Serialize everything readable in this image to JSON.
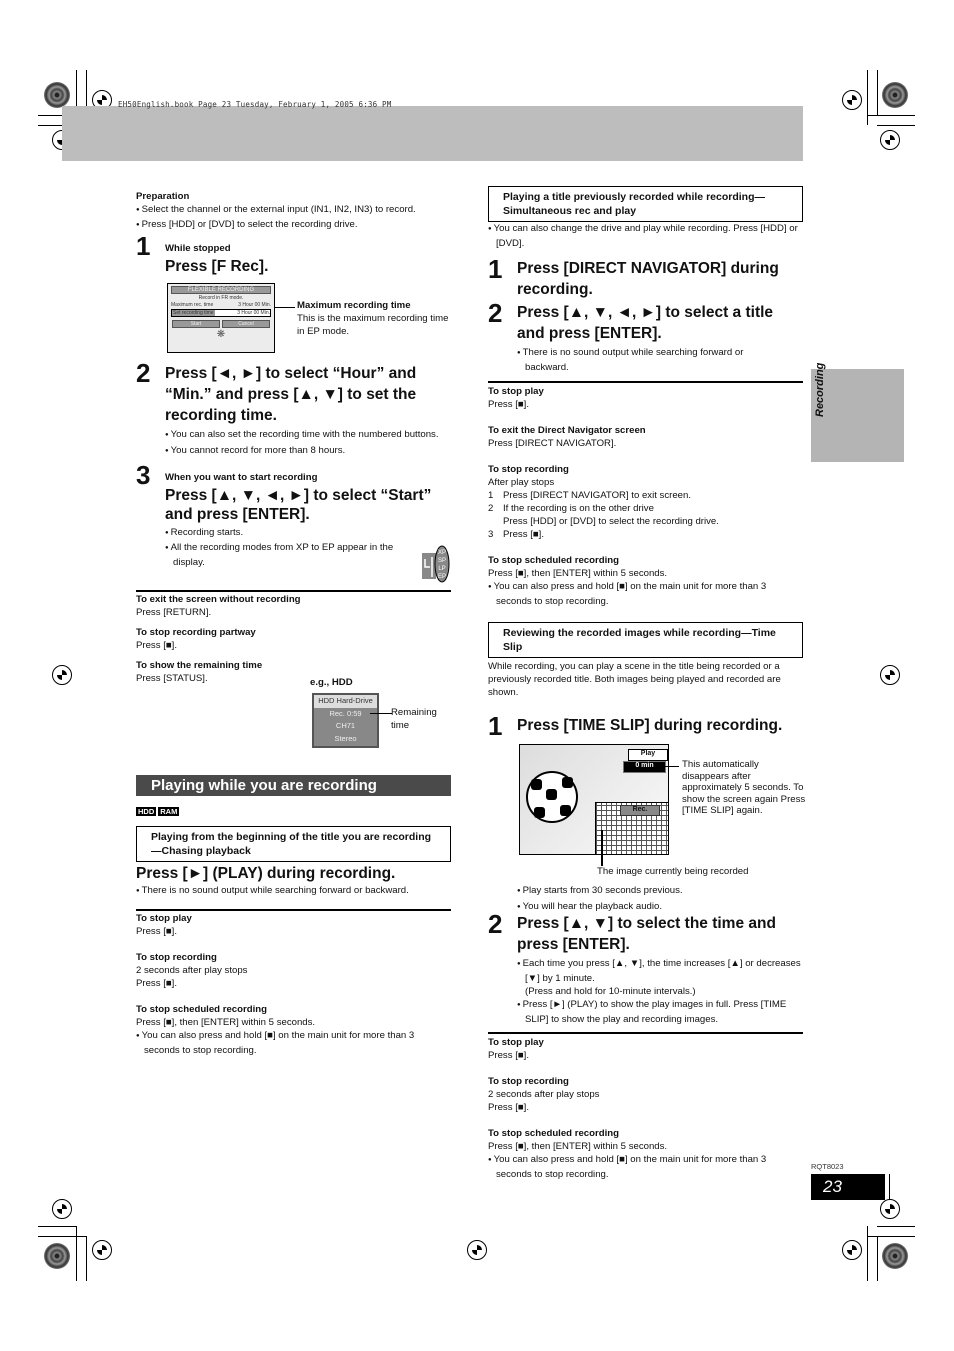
{
  "print_header": "EH50English.book  Page 23  Tuesday, February 1, 2005  6:36 PM",
  "side_tab": "Recording",
  "footer": {
    "code": "RQT8023",
    "page_number": "23"
  },
  "left": {
    "preparation": {
      "title": "Preparation",
      "bullets": [
        "Select the channel or the external input (IN1, IN2, IN3) to record.",
        "Press [HDD] or [DVD] to select the recording drive."
      ]
    },
    "step1": {
      "num": "1",
      "pre": "While stopped",
      "title": "Press [F Rec]."
    },
    "fr_screen": {
      "title": "FLEXIBLE RECORDING",
      "subtitle": "Record in FR mode.",
      "max_label": "Maximum rec. time",
      "max_value": "3 Hour 00 Min.",
      "set_label": "Set recording time",
      "set_value": "3 Hour 00 Min.",
      "start": "Start",
      "cancel": "Cancel",
      "callout_title": "Maximum recording time",
      "callout_text": "This is the maximum recording time in EP mode."
    },
    "step2": {
      "num": "2",
      "title": "Press [◄, ►] to select “Hour” and “Min.” and press [▲, ▼] to set the recording time.",
      "bullets": [
        "You can also set the recording time with the numbered buttons.",
        "You cannot record for more than 8 hours."
      ]
    },
    "step3": {
      "num": "3",
      "pre": "When you want to start recording",
      "title": "Press [▲, ▼, ◄, ►] to select “Start” and press [ENTER].",
      "bullets": [
        "Recording starts.",
        "All the recording modes from XP to EP appear in the display."
      ],
      "display_modes": [
        "XP",
        "SP",
        "LP",
        "EP"
      ]
    },
    "notes": [
      {
        "title": "To exit the screen without recording",
        "text": "Press [RETURN]."
      },
      {
        "title": "To stop recording partway",
        "text": "Press [■]."
      },
      {
        "title": "To show the remaining time",
        "text": "Press [STATUS]."
      }
    ],
    "hdd_example": {
      "label": "e.g., HDD",
      "lines": [
        "HDD Hard-Drive",
        "Rec. 0:59",
        "CH71",
        "Stereo"
      ],
      "callout": "Remaining time"
    },
    "section_title": "Playing while you are recording",
    "tags": [
      "HDD",
      "RAM"
    ],
    "chasing": {
      "box_title": "Playing from the beginning of the title you are recording—Chasing playback",
      "step": "Press [►] (PLAY) during recording.",
      "bullet": "There is no sound output while searching forward or backward."
    },
    "bottom_notes": [
      {
        "title": "To stop play",
        "lines": [
          "Press [■]."
        ]
      },
      {
        "title": "To stop recording",
        "lines": [
          "2 seconds after play stops",
          "Press [■]."
        ]
      },
      {
        "title": "To stop scheduled recording",
        "lines": [
          "Press [■], then [ENTER] within 5 seconds."
        ],
        "bullet": "You can also press and hold [■] on the main unit for more than 3 seconds to stop recording."
      }
    ]
  },
  "right": {
    "simul": {
      "box_title": "Playing a title previously recorded while recording—Simultaneous rec and play",
      "bullet": "You can also change the drive and play while recording. Press [HDD] or [DVD].",
      "step1": {
        "num": "1",
        "title": "Press [DIRECT NAVIGATOR] during recording."
      },
      "step2": {
        "num": "2",
        "title": "Press [▲, ▼, ◄, ►] to select a title and press [ENTER].",
        "bullet": "There is no sound output while searching forward or backward."
      }
    },
    "notes1": [
      {
        "title": "To stop play",
        "lines": [
          "Press [■]."
        ]
      },
      {
        "title": "To exit the Direct Navigator screen",
        "lines": [
          "Press [DIRECT NAVIGATOR]."
        ]
      }
    ],
    "stop_recording": {
      "title": "To stop recording",
      "intro": "After play stops",
      "items": [
        {
          "n": "1",
          "text": "Press [DIRECT NAVIGATOR] to exit screen."
        },
        {
          "n": "2",
          "text": "If the recording is on the other drive",
          "text2": "Press [HDD] or [DVD] to select the recording drive."
        },
        {
          "n": "3",
          "text": "Press [■]."
        }
      ]
    },
    "stop_scheduled": {
      "title": "To stop scheduled recording",
      "line": "Press [■], then [ENTER] within 5 seconds.",
      "bullet": "You can also press and hold [■] on the main unit for more than 3 seconds to stop recording."
    },
    "timeslip": {
      "box_title": "Reviewing the recorded images while recording—Time Slip",
      "intro": "While recording, you can play a scene in the title being recorded or a previously recorded title. Both images being played and recorded are shown.",
      "step1": {
        "num": "1",
        "title": "Press [TIME SLIP] during recording."
      },
      "image": {
        "play": "Play",
        "time": "0 min",
        "rec": "Rec."
      },
      "callout": "This automatically disappears after approximately 5 seconds. To show the screen again Press [TIME SLIP] again.",
      "caption": "The image currently being recorded",
      "bullets": [
        "Play starts from 30 seconds previous.",
        "You will hear the playback audio."
      ],
      "step2": {
        "num": "2",
        "title": "Press [▲, ▼] to select the time and press [ENTER].",
        "bullets": [
          "Each time you press [▲, ▼], the time increases [▲] or decreases [▼] by 1 minute.",
          "Press [►] (PLAY) to show the play images in full. Press [TIME SLIP] to show the play and recording images."
        ],
        "note": "(Press and hold for 10-minute intervals.)"
      }
    },
    "bottom_notes": [
      {
        "title": "To stop play",
        "lines": [
          "Press [■]."
        ]
      },
      {
        "title": "To stop recording",
        "lines": [
          "2 seconds after play stops",
          "Press [■]."
        ]
      },
      {
        "title": "To stop scheduled recording",
        "lines": [
          "Press [■], then [ENTER] within 5 seconds."
        ],
        "bullet": "You can also press and hold [■] on the main unit for more than 3 seconds to stop recording."
      }
    ]
  }
}
